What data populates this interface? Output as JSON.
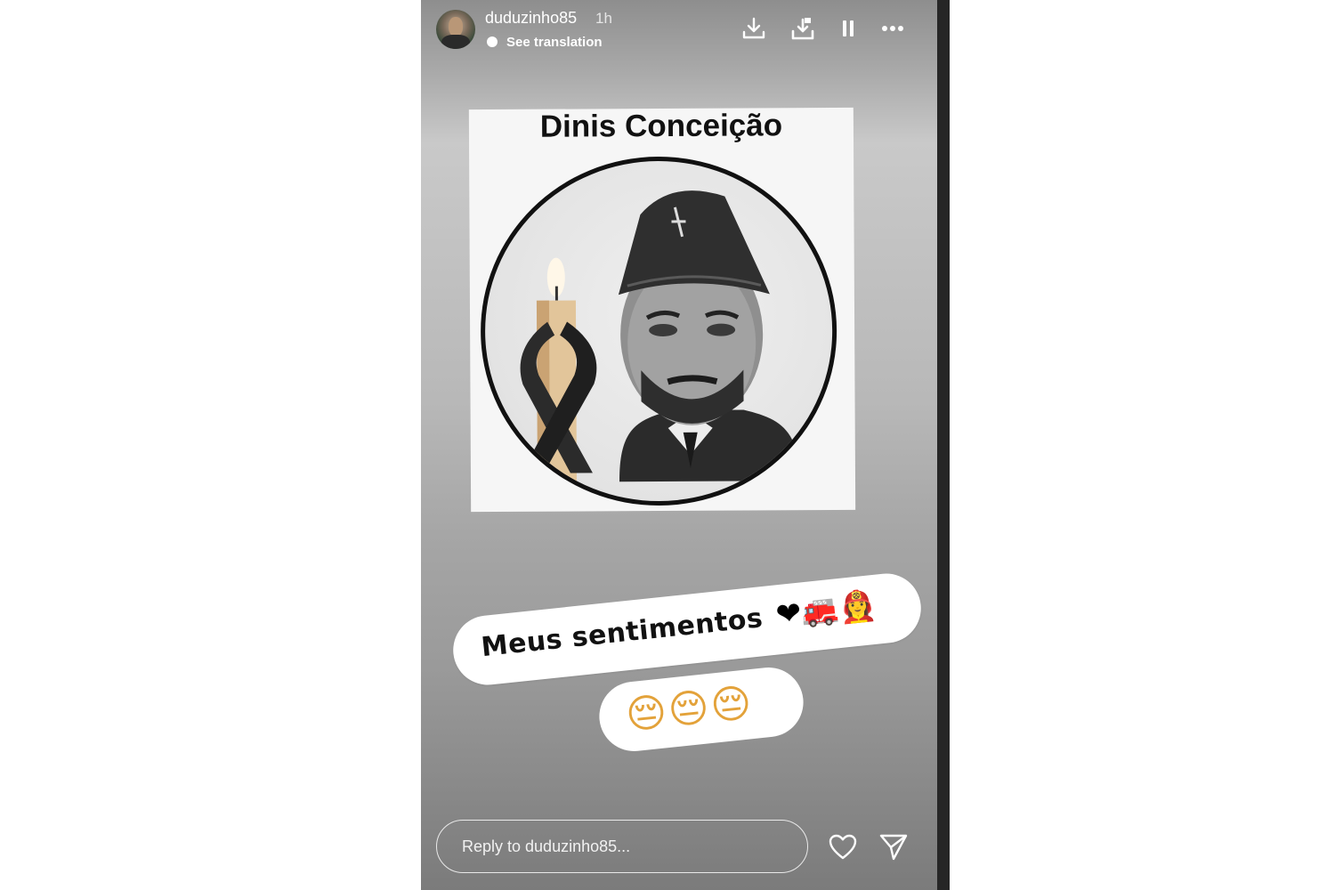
{
  "story": {
    "username": "duduzinho85",
    "time": "1h",
    "see_translation": "See translation",
    "post_title": "Dinis Conceição",
    "sticker_text": "Meus sentimentos",
    "sticker_emojis": "❤🚒👩‍🚒",
    "faces": "😔😔😔",
    "reply_placeholder": "Reply to duduzinho85..."
  },
  "icons": {
    "download": "download-icon",
    "save": "save-to-device-icon",
    "pause": "pause-icon",
    "more": "more-options-icon",
    "like": "heart-icon",
    "share": "send-icon"
  },
  "colors": {
    "ring": "#111111",
    "text_light": "#ffffff",
    "sticker_bg": "#ffffff"
  }
}
